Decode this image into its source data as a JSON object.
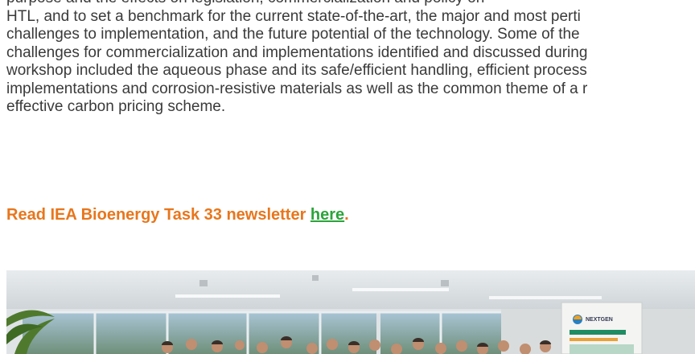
{
  "article": {
    "lines": [
      "purpose and the effects on legislation, commercialization and policy on",
      "HTL, and to set a benchmark for the current state-of-the-art, the major and most perti",
      "challenges to implementation, and the future potential of the technology. Some of the",
      "challenges for commercialization and implementations identified and discussed during",
      "workshop included the aqueous phase and its safe/efficient handling, efficient process",
      "implementations and corrosion-resistive materials as well as the common theme of a r",
      "effective carbon pricing scheme."
    ],
    "cta_prefix": "Read IEA Bioenergy Task 33 newsletter ",
    "cta_link": "here",
    "cta_suffix": "."
  },
  "photo": {
    "banner_text": "NEXTGEN"
  },
  "colors": {
    "body_text": "#3a3a3a",
    "cta_orange": "#e8761c",
    "link_green": "#2aa53a"
  }
}
